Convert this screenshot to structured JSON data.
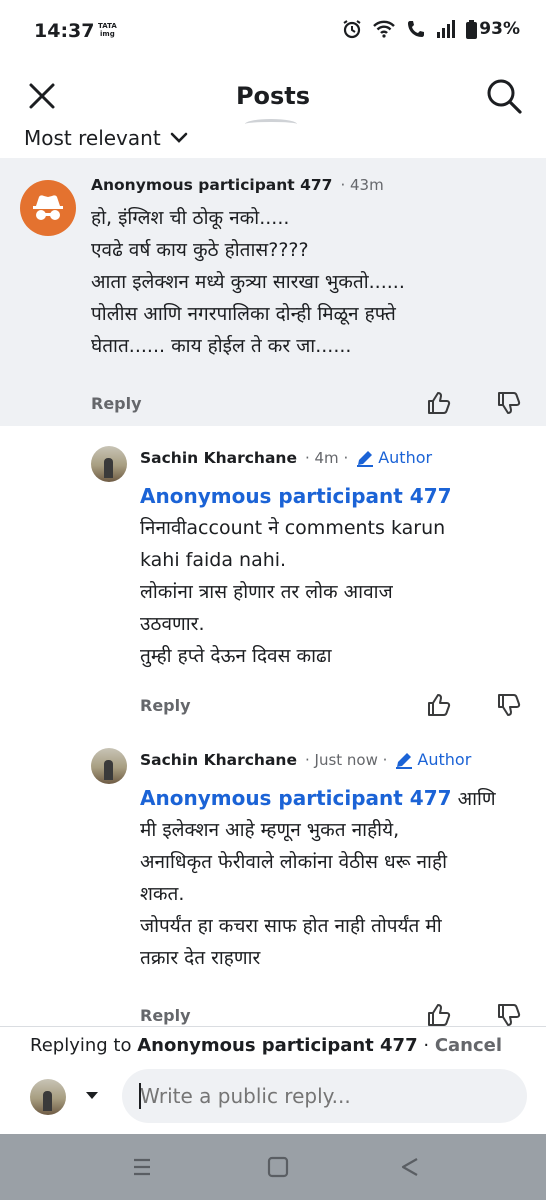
{
  "status": {
    "time": "14:37",
    "carrier_logo": "TATA img",
    "battery": "93%",
    "icons": [
      "alarm-icon",
      "wifi-icon",
      "wifi-calling-icon",
      "signal-icon",
      "battery-icon"
    ]
  },
  "header": {
    "title": "Posts",
    "sort_label": "Most relevant"
  },
  "comments": [
    {
      "author": "Anonymous participant 477",
      "time": "43m",
      "text": "हो, इंग्लिश ची ठोकू नको.....\nएवढे वर्ष काय कुठे होतास????\nआता इलेक्शन मध्ये कुत्र्या सारखा भुकतो......\nपोलीस आणि नगरपालिका दोन्ही मिळून हफ्ते\nघेतात...... काय होईल ते कर जा......",
      "reply_label": "Reply"
    },
    {
      "author": "Sachin Kharchane",
      "time": "4m",
      "badge": "Author",
      "mention": "Anonymous participant 477",
      "text": "निनावीaccount ने comments karun\nkahi faida nahi.\nलोकांना त्रास होणार तर लोक आवाज\nउठवणार.\nतुम्ही हप्ते देऊन दिवस काढा",
      "reply_label": "Reply"
    },
    {
      "author": "Sachin Kharchane",
      "time": "Just now",
      "badge": "Author",
      "mention": "Anonymous participant 477",
      "text_after_mention": " आणि",
      "text": "मी इलेक्शन आहे म्हणून भुकत नाहीये,\nअनाधिकृत फेरीवाले लोकांना वेठीस धरू नाही\nशकत.\nजोपर्यंत हा कचरा साफ होत नाही तोपर्यंत मी\nतक्रार देत राहणार",
      "reply_label": "Reply"
    }
  ],
  "composer": {
    "replying_prefix": "Replying to",
    "replying_to": "Anonymous participant 477",
    "separator": "·",
    "cancel_label": "Cancel",
    "placeholder": "Write a public reply..."
  },
  "colors": {
    "accent": "#1b63d6",
    "highlight_bg": "#eff1f4",
    "anon_avatar": "#e4722f",
    "nav_bg": "#9aa0a6"
  }
}
